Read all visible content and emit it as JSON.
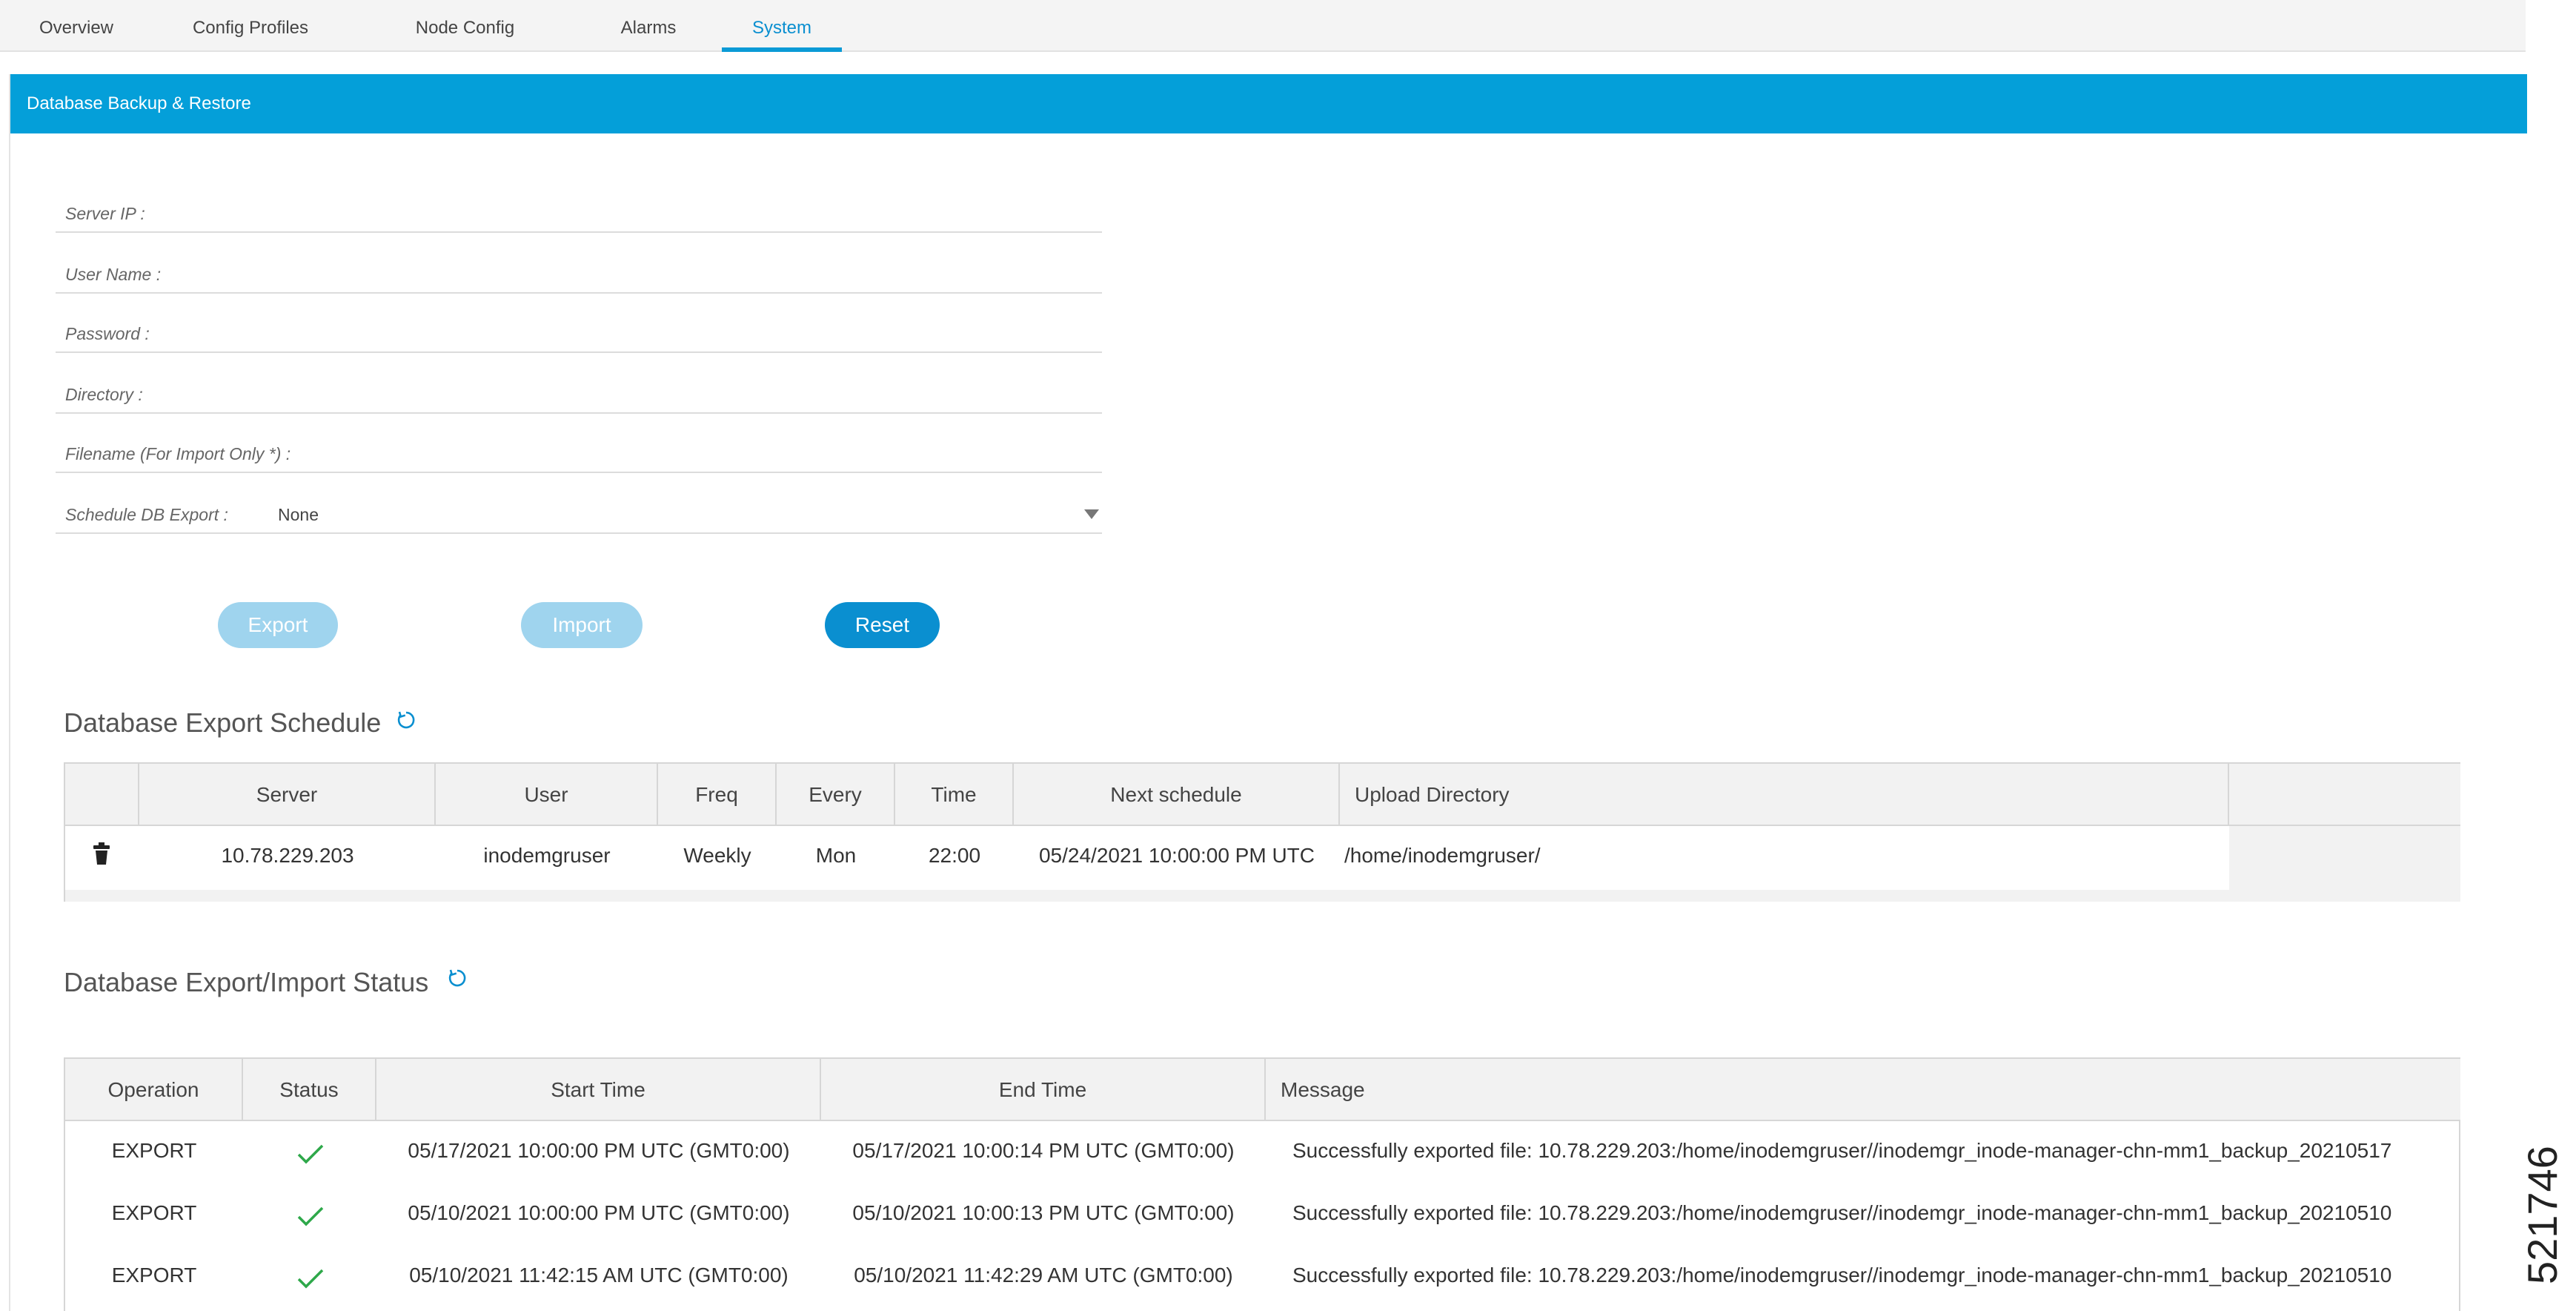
{
  "tabs": [
    {
      "label": "Overview"
    },
    {
      "label": "Config Profiles"
    },
    {
      "label": "Node Config"
    },
    {
      "label": "Alarms"
    },
    {
      "label": "System"
    }
  ],
  "panel": {
    "title": "Database Backup & Restore"
  },
  "form": {
    "server_ip_label": "Server IP :",
    "user_name_label": "User Name :",
    "password_label": "Password :",
    "directory_label": "Directory :",
    "filename_label": "Filename (For Import Only *) :",
    "schedule_label": "Schedule DB Export :",
    "schedule_value": "None"
  },
  "buttons": {
    "export": "Export",
    "import": "Import",
    "reset": "Reset"
  },
  "export_schedule": {
    "title": "Database Export Schedule",
    "columns": [
      "",
      "Server",
      "User",
      "Freq",
      "Every",
      "Time",
      "Next schedule",
      "Upload Directory",
      ""
    ],
    "rows": [
      {
        "server": "10.78.229.203",
        "user": "inodemgruser",
        "freq": "Weekly",
        "every": "Mon",
        "time": "22:00",
        "next": "05/24/2021 10:00:00 PM UTC",
        "dir": "/home/inodemgruser/"
      }
    ]
  },
  "status": {
    "title": "Database Export/Import Status",
    "columns": [
      "Operation",
      "Status",
      "Start Time",
      "End Time",
      "Message"
    ],
    "rows": [
      {
        "operation": "EXPORT",
        "start": "05/17/2021 10:00:00 PM UTC (GMT0:00)",
        "end": "05/17/2021 10:00:14 PM UTC (GMT0:00)",
        "message": "Successfully exported file: 10.78.229.203:/home/inodemgruser//inodemgr_inode-manager-chn-mm1_backup_20210517"
      },
      {
        "operation": "EXPORT",
        "start": "05/10/2021 10:00:00 PM UTC (GMT0:00)",
        "end": "05/10/2021 10:00:13 PM UTC (GMT0:00)",
        "message": "Successfully exported file: 10.78.229.203:/home/inodemgruser//inodemgr_inode-manager-chn-mm1_backup_20210510"
      },
      {
        "operation": "EXPORT",
        "start": "05/10/2021 11:42:15 AM UTC (GMT0:00)",
        "end": "05/10/2021 11:42:29 AM UTC (GMT0:00)",
        "message": "Successfully exported file: 10.78.229.203:/home/inodemgruser//inodemgr_inode-manager-chn-mm1_backup_20210510"
      }
    ]
  },
  "figure_id": "521746",
  "colors": {
    "accent": "#049fd9",
    "button_primary": "#0a8fd0",
    "button_disabled": "#9fd4ee",
    "success_check": "#2ea84a"
  },
  "icons": {
    "refresh": "refresh-icon",
    "delete": "trash-icon",
    "status_ok": "checkmark-icon",
    "dropdown": "caret-down-icon"
  }
}
